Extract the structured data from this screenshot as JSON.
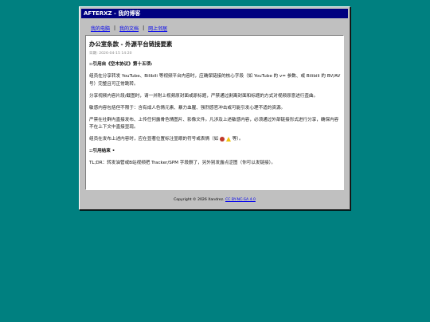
{
  "window": {
    "title": "AFTERXZ - 我的博客"
  },
  "nav": {
    "items": [
      "我的电脑",
      "我的文档",
      "网上邻居"
    ],
    "separator": "|"
  },
  "article": {
    "title": "办公室条款 - 外源平台链接要素",
    "meta": "日期: 2026-04-15 14:20",
    "quote_header": "::引用自《空木协议》第十五项:",
    "paragraphs": [
      "组员在分享转发 YouTube、Bilibili 等视频平台内容时，应确保链接的核心字段（如 YouTube 的 v= 参数、或 Bilibili 的 BV/AV 号）完整且可正常跳转。",
      "分享视频内容片段/截图时，请一并附上视频原封面或原标题，严禁通过剥离封面和标题的方式对视频原意进行歪曲。",
      "敏感内容包括但不限于：含有成人色情元素、暴力血腥、强烈感官冲击或可能引发心理不适的资源。",
      "严禁在社群内直接发布、上传任何露骨色情图片、影像文件。凡涉及上述敏感内容，必须通过外部链接形式进行分享，确保内容不在上下文中直接显现。",
      "组员在发布上述内容时，应在显著位置标注显眼的符号或表情（如"
    ],
    "para5_suffix": "等）。",
    "quote_footer": "::引用结束 •",
    "tldr": "TL;DR：转发油管或B站视频把 Tracker/SPM 字段删了，另外别发露点涩图（你可以发链接）。"
  },
  "footer": {
    "copyright": "Copyright © 2026 Xandrez.",
    "license": "CC BY-NC-SA 4.0"
  },
  "colors": {
    "desktop": "#008080",
    "titlebar": "#000080",
    "link": "#0000ee"
  }
}
